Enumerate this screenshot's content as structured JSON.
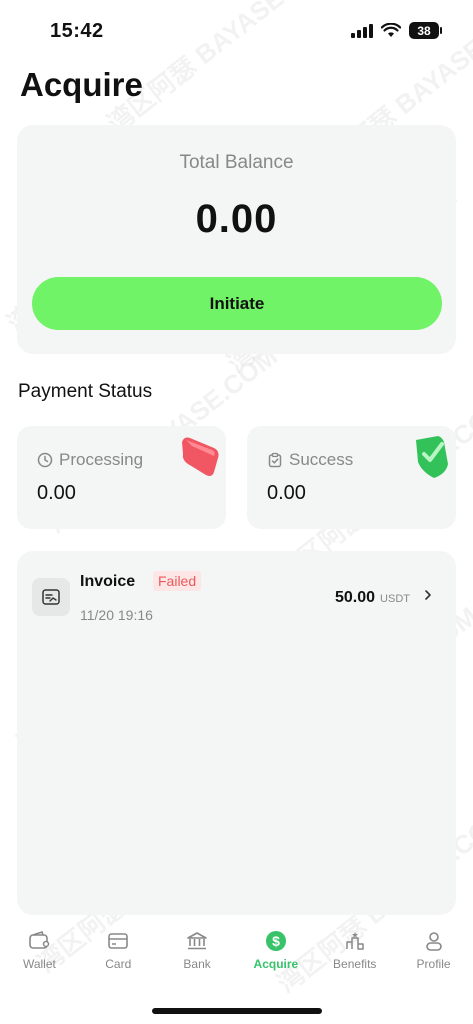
{
  "status_bar": {
    "time": "15:42",
    "battery": "38"
  },
  "page": {
    "title": "Acquire"
  },
  "balance": {
    "label": "Total Balance",
    "value": "0.00",
    "button_label": "Initiate"
  },
  "payment_status": {
    "title": "Payment Status",
    "processing": {
      "label": "Processing",
      "value": "0.00"
    },
    "success": {
      "label": "Success",
      "value": "0.00"
    }
  },
  "invoices": [
    {
      "title": "Invoice",
      "status": "Failed",
      "date": "11/20 19:16",
      "amount": "50.00",
      "currency": "USDT"
    }
  ],
  "tabs": [
    {
      "label": "Wallet",
      "icon": "wallet-icon",
      "active": false
    },
    {
      "label": "Card",
      "icon": "card-icon",
      "active": false
    },
    {
      "label": "Bank",
      "icon": "bank-icon",
      "active": false
    },
    {
      "label": "Acquire",
      "icon": "dollar-icon",
      "active": true
    },
    {
      "label": "Benefits",
      "icon": "benefits-icon",
      "active": false
    },
    {
      "label": "Profile",
      "icon": "profile-icon",
      "active": false
    }
  ],
  "colors": {
    "accent": "#71f367",
    "active_tab": "#38c26a",
    "failed": "#ea5a5a",
    "card_bg": "#f4f5f5"
  },
  "watermark": "湾区阿瑟 BAYASE.COM"
}
